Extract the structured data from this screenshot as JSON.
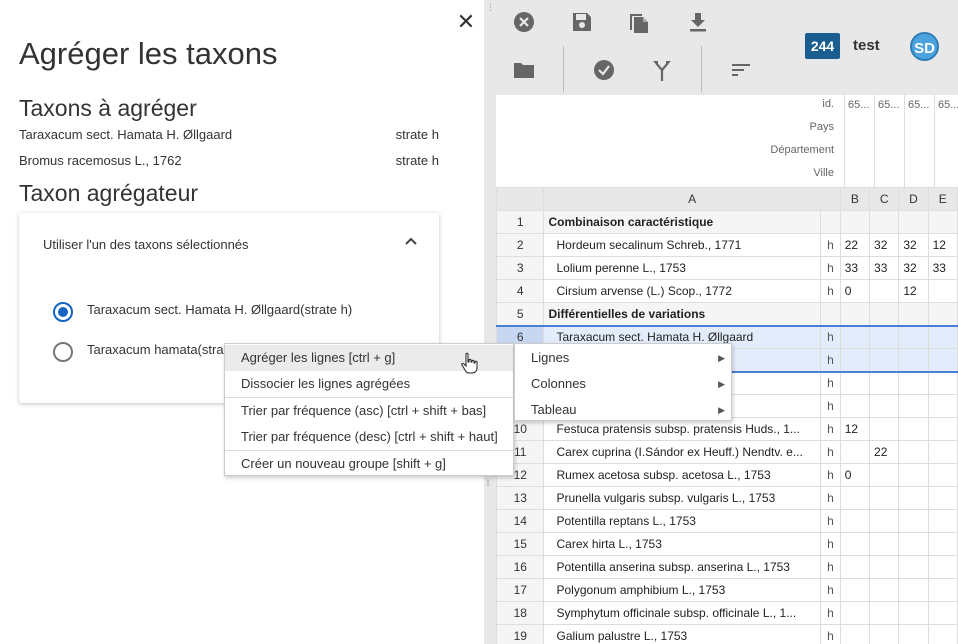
{
  "drawer": {
    "title": "Agréger les taxons",
    "to_aggregate_heading": "Taxons à agréger",
    "to_aggregate": [
      {
        "name": "Taraxacum sect. Hamata H. Øllgaard",
        "stratum": "strate h"
      },
      {
        "name": "Bromus racemosus L., 1762",
        "stratum": "strate h"
      }
    ],
    "aggregator_heading": "Taxon agrégateur",
    "panel_title": "Utiliser l'un des taxons sélectionnés",
    "options": [
      {
        "label": "Taraxacum sect. Hamata H. Øllgaard(strate h)",
        "selected": true
      },
      {
        "label": "Taraxacum hamata(stra",
        "selected": false
      }
    ],
    "close_icon": "close-icon"
  },
  "toolbar": {
    "icons": [
      "cancel-circle-icon",
      "save-icon",
      "copy-icon",
      "download-icon",
      "folder-icon",
      "check-circle-icon",
      "merge-icon",
      "sort-icon"
    ],
    "count": "244",
    "user": "test",
    "avatar": "SD"
  },
  "sheet": {
    "meta_labels": [
      "id.",
      "Pays",
      "Département",
      "Ville"
    ],
    "meta_id_values": [
      "65...",
      "65...",
      "65...",
      "65..."
    ],
    "columns": [
      "A",
      "B",
      "C",
      "D",
      "E"
    ],
    "rows": [
      {
        "n": "1",
        "name": "Combinaison caractéristique",
        "group": true,
        "h": "",
        "vals": [
          "",
          "",
          "",
          ""
        ]
      },
      {
        "n": "2",
        "name": "Hordeum secalinum Schreb., 1771",
        "group": false,
        "h": "h",
        "vals": [
          "22",
          "32",
          "32",
          "12"
        ]
      },
      {
        "n": "3",
        "name": "Lolium perenne L., 1753",
        "group": false,
        "h": "h",
        "vals": [
          "33",
          "33",
          "32",
          "33"
        ]
      },
      {
        "n": "4",
        "name": "Cirsium arvense (L.) Scop., 1772",
        "group": false,
        "h": "h",
        "vals": [
          "0",
          "",
          "12",
          ""
        ]
      },
      {
        "n": "5",
        "name": "Différentielles de variations",
        "group": true,
        "h": "",
        "vals": [
          "",
          "",
          "",
          ""
        ]
      },
      {
        "n": "6",
        "name": "Taraxacum sect. Hamata H. Øllgaard",
        "group": false,
        "h": "h",
        "vals": [
          "",
          "",
          "",
          ""
        ],
        "selected": true
      },
      {
        "n": "7",
        "name": "",
        "group": false,
        "h": "h",
        "vals": [
          "",
          "",
          "",
          ""
        ],
        "selected": true
      },
      {
        "n": "8",
        "name": "lgare (Hartm...",
        "group": false,
        "h": "h",
        "vals": [
          "",
          "",
          "",
          ""
        ]
      },
      {
        "n": "9",
        "name": "",
        "group": false,
        "h": "h",
        "vals": [
          "",
          "",
          "",
          ""
        ]
      },
      {
        "n": "10",
        "name": "Festuca pratensis subsp. pratensis Huds., 1...",
        "group": false,
        "h": "h",
        "vals": [
          "12",
          "",
          "",
          ""
        ]
      },
      {
        "n": "11",
        "name": "Carex cuprina (I.Sándor ex Heuff.) Nendtv. e...",
        "group": false,
        "h": "h",
        "vals": [
          "",
          "22",
          "",
          ""
        ]
      },
      {
        "n": "12",
        "name": "Rumex acetosa subsp. acetosa L., 1753",
        "group": false,
        "h": "h",
        "vals": [
          "0",
          "",
          "",
          ""
        ]
      },
      {
        "n": "13",
        "name": "Prunella vulgaris subsp. vulgaris L., 1753",
        "group": false,
        "h": "h",
        "vals": [
          "",
          "",
          "",
          ""
        ]
      },
      {
        "n": "14",
        "name": "Potentilla reptans L., 1753",
        "group": false,
        "h": "h",
        "vals": [
          "",
          "",
          "",
          ""
        ]
      },
      {
        "n": "15",
        "name": "Carex hirta L., 1753",
        "group": false,
        "h": "h",
        "vals": [
          "",
          "",
          "",
          ""
        ]
      },
      {
        "n": "16",
        "name": "Potentilla anserina subsp. anserina L., 1753",
        "group": false,
        "h": "h",
        "vals": [
          "",
          "",
          "",
          ""
        ]
      },
      {
        "n": "17",
        "name": "Polygonum amphibium L., 1753",
        "group": false,
        "h": "h",
        "vals": [
          "",
          "",
          "",
          ""
        ]
      },
      {
        "n": "18",
        "name": "Symphytum officinale subsp. officinale L., 1...",
        "group": false,
        "h": "h",
        "vals": [
          "",
          "",
          "",
          ""
        ]
      },
      {
        "n": "19",
        "name": "Galium palustre L., 1753",
        "group": false,
        "h": "h",
        "vals": [
          "",
          "",
          "",
          ""
        ]
      }
    ]
  },
  "context_menu": {
    "items": [
      "Agréger les lignes [ctrl + g]",
      "Dissocier les lignes agrégées",
      "Trier par fréquence (asc) [ctrl + shift + bas]",
      "Trier par fréquence (desc) [ctrl + shift + haut]",
      "Créer un nouveau groupe [shift + g]"
    ],
    "submenu": [
      "Lignes",
      "Colonnes",
      "Tableau"
    ]
  }
}
